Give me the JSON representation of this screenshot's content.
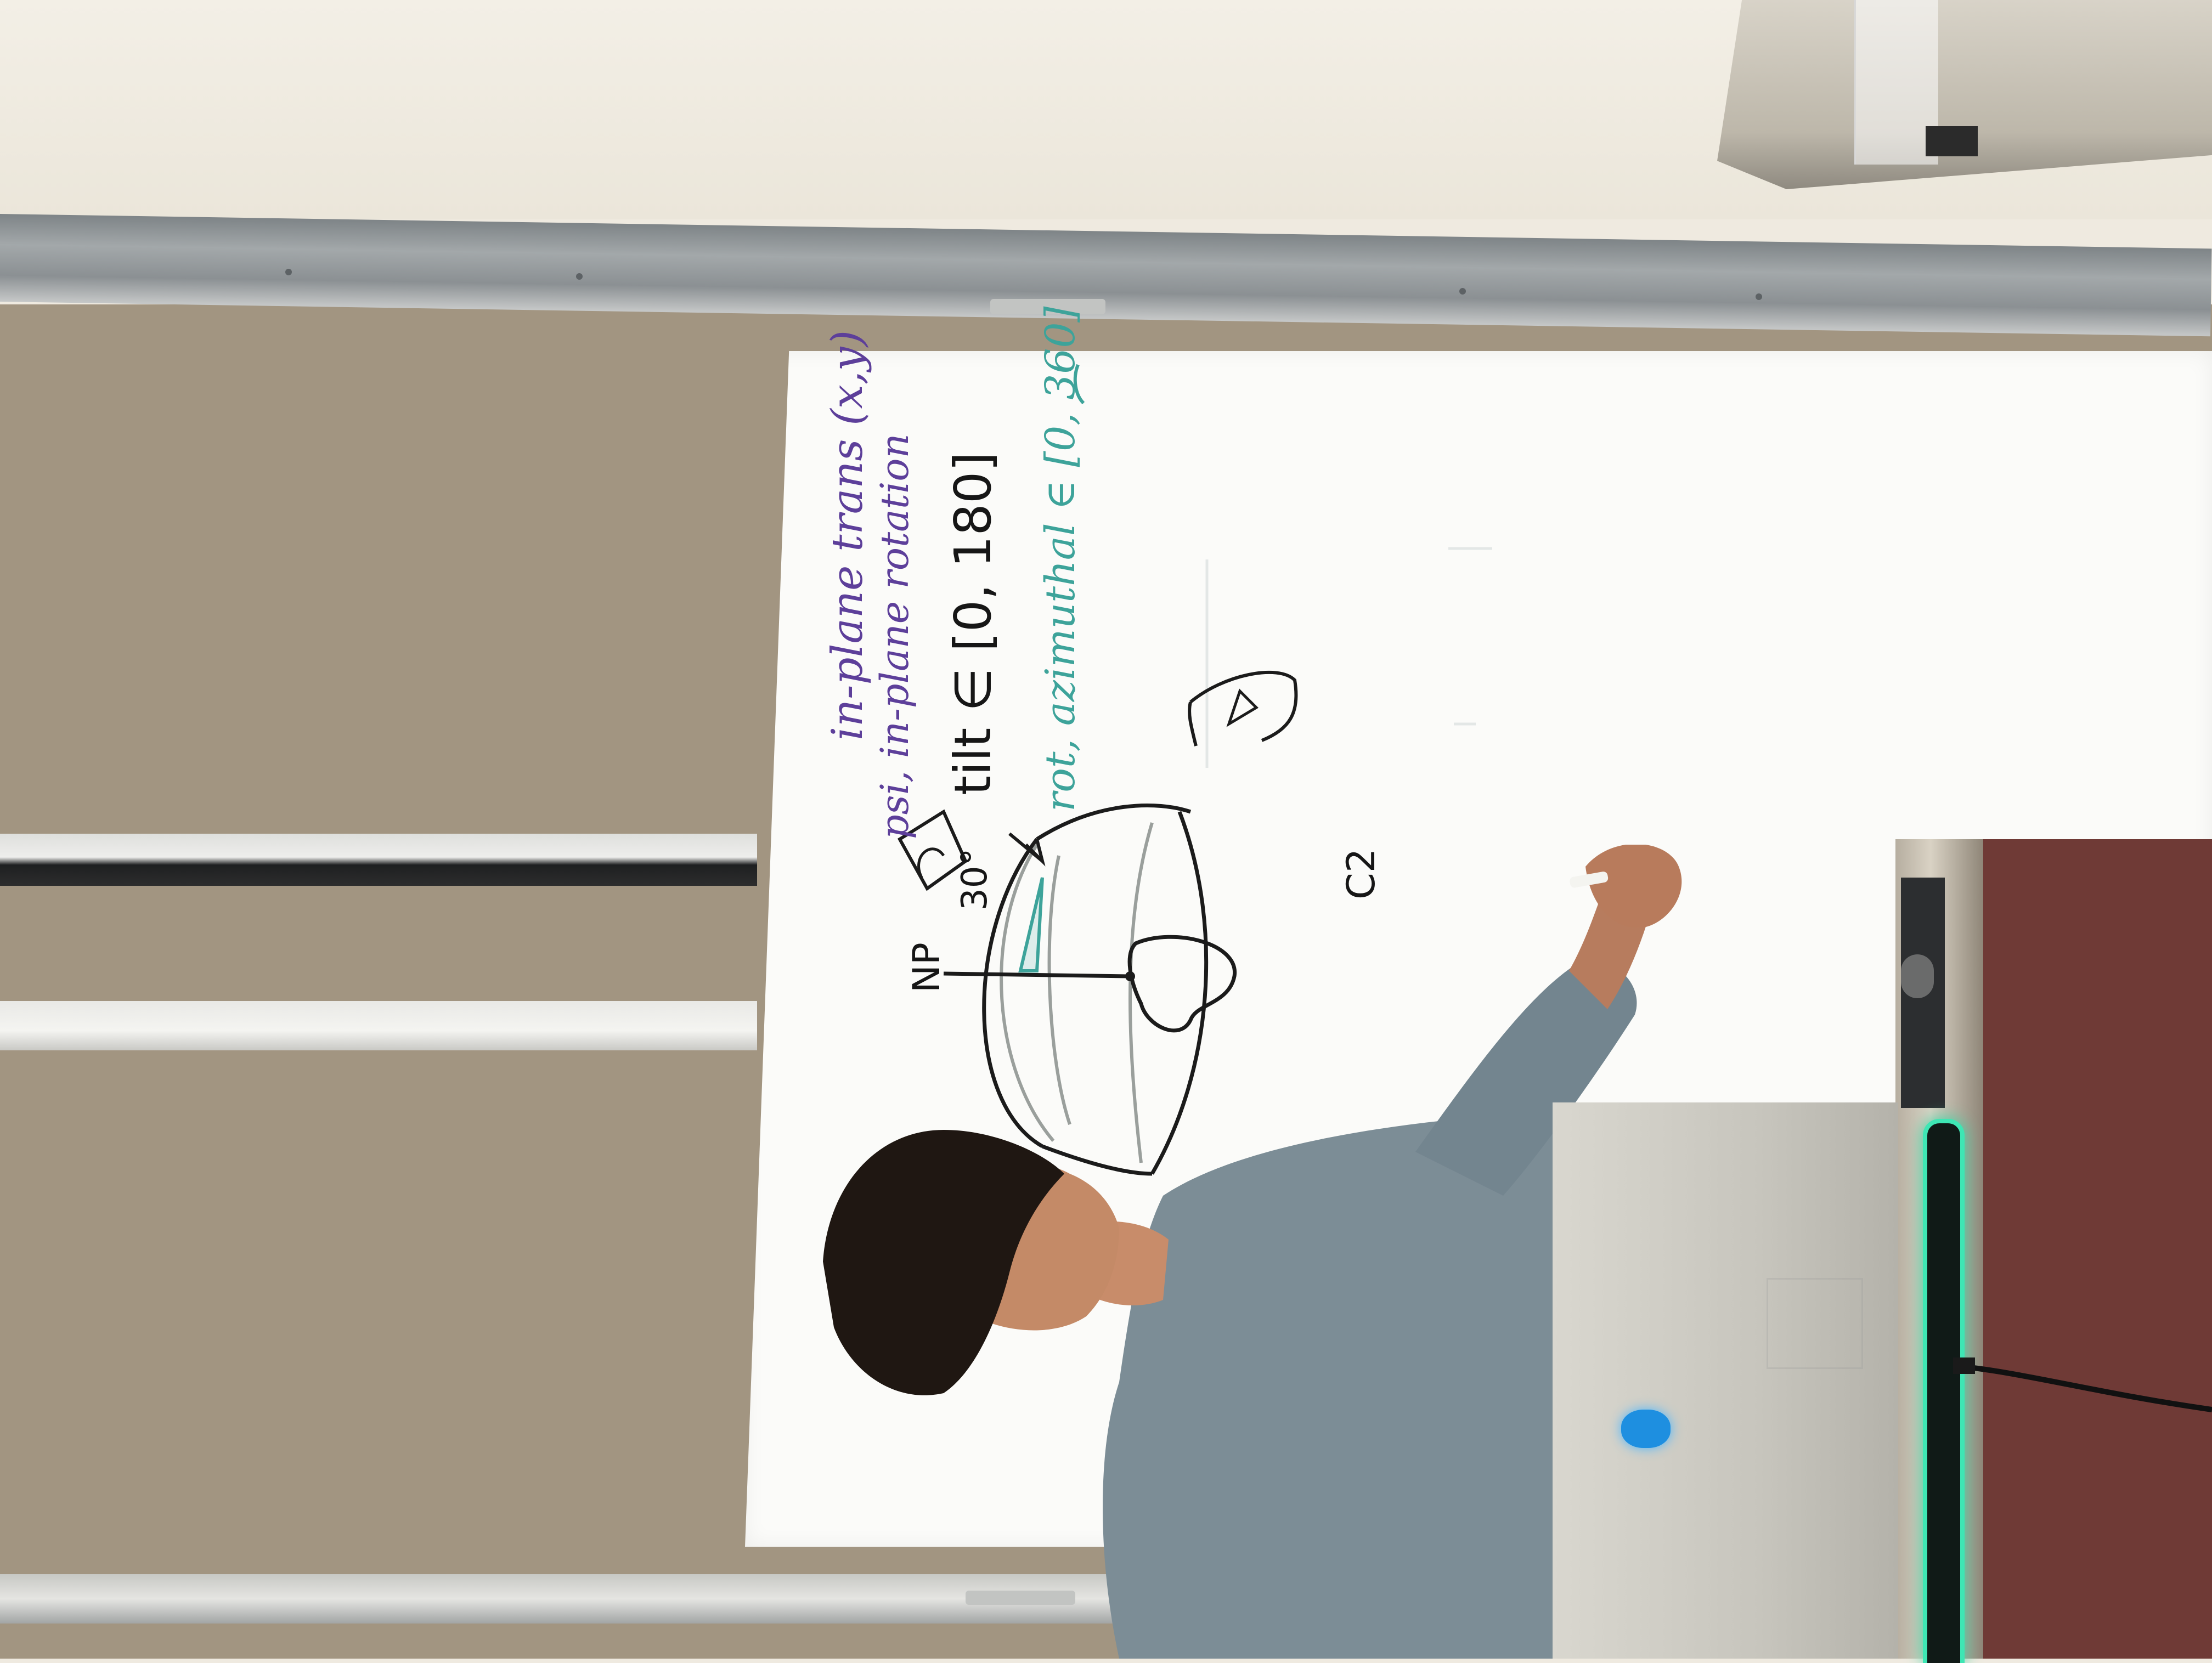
{
  "scene": {
    "description_free": true
  },
  "whiteboard": {
    "lines": {
      "purple_1": "in-plane trans (x,y)",
      "purple_2": "psi, in-plane rotation",
      "black_1": "tilt ∈ [0, 180]",
      "teal_1": "rot, azimuthal ∈ [0, 360]",
      "np_label": "NP",
      "angle_label": "30°",
      "c2_label": "C2"
    }
  },
  "colors": {
    "ink_purple": "#5d3f9a",
    "ink_black": "#161616",
    "ink_teal": "#3da39a",
    "led": "#3ee6b4"
  }
}
